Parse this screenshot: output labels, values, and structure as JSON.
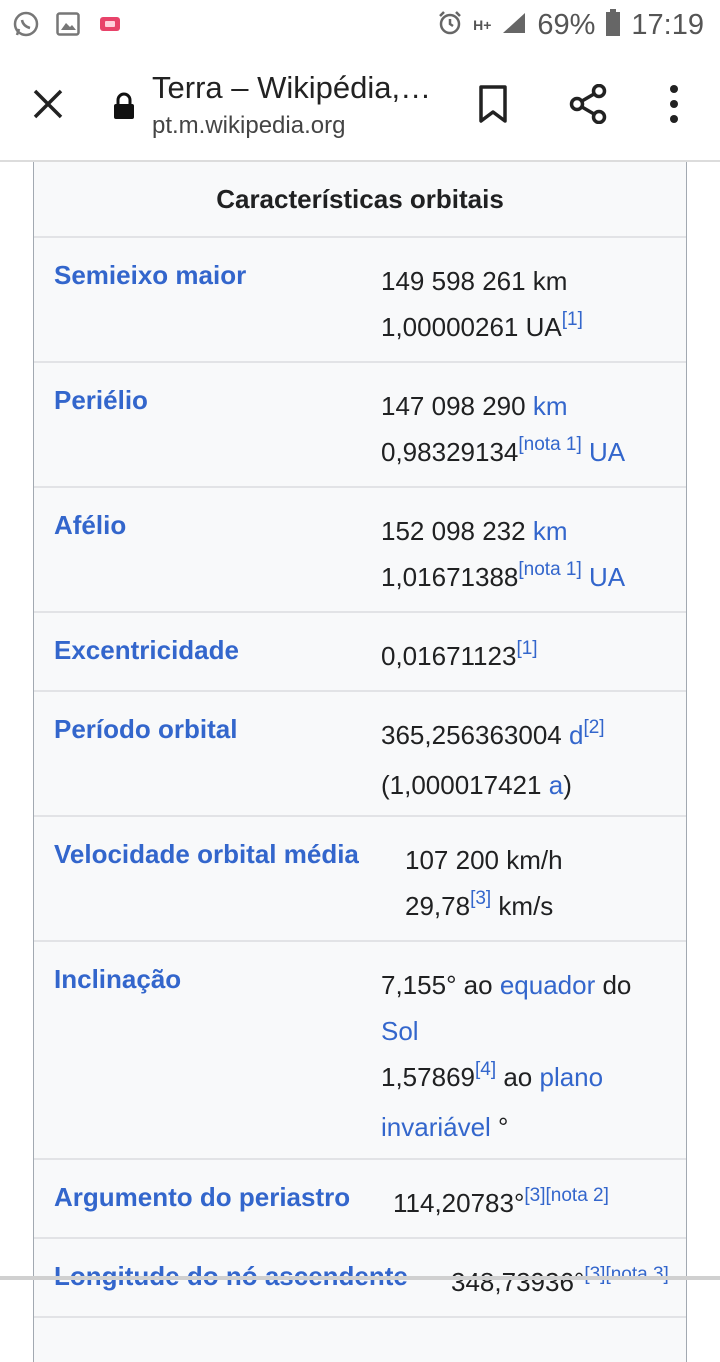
{
  "status_bar": {
    "battery": "69%",
    "time": "17:19",
    "network": "H+",
    "icons": [
      "whatsapp-icon",
      "gallery-icon",
      "notification-icon",
      "alarm-icon",
      "signal-icon",
      "battery-icon"
    ]
  },
  "toolbar": {
    "title": "Terra – Wikipédia,…",
    "url": "pt.m.wikipedia.org",
    "icons": [
      "close-icon",
      "lock-icon",
      "bookmark-icon",
      "share-icon",
      "more-icon"
    ]
  },
  "infobox": {
    "header": "Características orbitais",
    "rows": [
      {
        "label": "Semieixo maior",
        "lines": [
          [
            {
              "t": "149 598 261 km"
            }
          ],
          [
            {
              "t": "1,00000261 UA"
            },
            {
              "t": "[1]",
              "sup": true
            }
          ]
        ]
      },
      {
        "label": "Periélio",
        "lines": [
          [
            {
              "t": "147 098 290 "
            },
            {
              "t": "km",
              "link": true
            }
          ],
          [
            {
              "t": "0,98329134"
            },
            {
              "t": "[nota 1]",
              "sup": true
            },
            {
              "t": " "
            },
            {
              "t": "UA",
              "link": true
            }
          ]
        ]
      },
      {
        "label": "Afélio",
        "lines": [
          [
            {
              "t": "152 098 232 "
            },
            {
              "t": "km",
              "link": true
            }
          ],
          [
            {
              "t": "1,01671388"
            },
            {
              "t": "[nota 1]",
              "sup": true
            },
            {
              "t": " "
            },
            {
              "t": "UA",
              "link": true
            }
          ]
        ]
      },
      {
        "label": "Excentricidade",
        "lines": [
          [
            {
              "t": "0,01671123"
            },
            {
              "t": "[1]",
              "sup": true
            }
          ]
        ]
      },
      {
        "label": "Período orbital",
        "lines": [
          [
            {
              "t": "365,256363004 "
            },
            {
              "t": "d",
              "link": true
            },
            {
              "t": "[2]",
              "sup": true
            }
          ],
          [
            {
              "t": "(1,000017421 "
            },
            {
              "t": "a",
              "link": true
            },
            {
              "t": ")"
            }
          ]
        ]
      },
      {
        "label": "Velocidade orbital média",
        "lines": [
          [
            {
              "t": "107 200 km/h"
            }
          ],
          [
            {
              "t": "29,78"
            },
            {
              "t": "[3]",
              "sup": true
            },
            {
              "t": " km/s"
            }
          ]
        ]
      },
      {
        "label": "Inclinação",
        "lines": [
          [
            {
              "t": "7,155° ao "
            },
            {
              "t": "equador",
              "link": true
            },
            {
              "t": " do"
            }
          ],
          [
            {
              "t": "Sol",
              "link": true
            }
          ],
          [
            {
              "t": "1,57869"
            },
            {
              "t": "[4]",
              "sup": true
            },
            {
              "t": " ao "
            },
            {
              "t": "plano",
              "link": true
            }
          ],
          [
            {
              "t": "invariável",
              "link": true
            },
            {
              "t": " °"
            }
          ]
        ]
      },
      {
        "label": "Argumento do periastro",
        "lines": [
          [
            {
              "t": "114,20783°"
            },
            {
              "t": "[3]",
              "sup": true
            },
            {
              "t": "[nota 2]",
              "sup": true
            }
          ]
        ]
      },
      {
        "label": "Longitude do nó ascendente",
        "lines": [
          [
            {
              "t": "348,73936°"
            },
            {
              "t": "[3]",
              "sup": true
            },
            {
              "t": "[nota 3]",
              "sup": true
            }
          ]
        ]
      }
    ]
  }
}
